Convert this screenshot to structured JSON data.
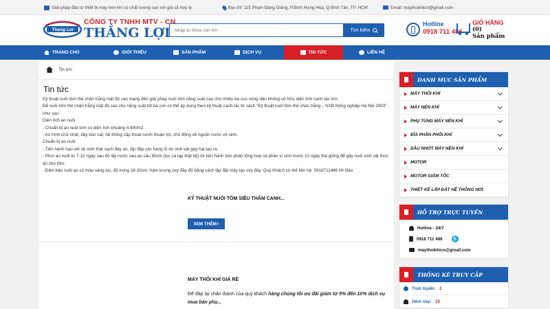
{
  "topbar": {
    "slogan": "Giải pháp đầu tư thiết bị máy nén khí có chất lượng cao với giá cả hợp lý",
    "address": "Địa chỉ: 115 Phạm Đăng Giảng, P.Bình Hưng Hòa, Q.Bình Tân, TP. HCM",
    "email": "Email: maythoikhicn@gmail.com"
  },
  "header": {
    "logo_text": "Thang Loi",
    "company_line1": "CÔNG TY TNHH MTV - CN",
    "company_line2": "THẮNG LỢI",
    "search_placeholder": "Nhập từ khóa cần tìm",
    "search_button": "Tìm kiếm",
    "hotline_label": "Hotline",
    "hotline_number": "0918 711 486",
    "cart_label": "GIỎ HÀNG",
    "cart_count": "(0)",
    "cart_unit": "Sản phẩm"
  },
  "nav": {
    "items": [
      {
        "label": "TRANG CHỦ",
        "icon": "home-icon"
      },
      {
        "label": "GIỚI THIỆU",
        "icon": "info-icon"
      },
      {
        "label": "SẢN PHẨM",
        "icon": "truck-icon"
      },
      {
        "label": "DỊCH VỤ",
        "icon": "service-icon"
      },
      {
        "label": "TIN TỨC",
        "icon": "news-icon",
        "active": true
      },
      {
        "label": "LIÊN HỆ",
        "icon": "contact-icon"
      }
    ]
  },
  "breadcrumb": {
    "current": "Tin tức"
  },
  "main": {
    "title": "Tin tức",
    "paragraphs": [
      "Kỹ thuật nuôi tôm thẻ chân trắng mật độ cao mang đến giải pháp nuôi tôm năng suất cao cho nhiều bà con nông dân không sở hữu diện tích canh tác lớn.",
      "Để nuôi tôm thẻ chân trắng mật độ cao cho năng suất tốt bà con có thể áp dụng theo kỹ thuật canh tác từ sách \"Kỹ thuật nuôi tôm thẻ chân trắng – NXB Nông nghiệp Hà Nội 2003\" như sau:",
      "Diện tích ao nuôi",
      "- Chuẩn bị ao nuôi tôm có diện tích khoảng 4.600m2.",
      "- Ao hình chữ nhật, đáy bùn cát, hệ thống cấp thoát nước thuận lợi, chủ động về nguồn nước vệ sinh.",
      "Chuẩn bị ao nuôi",
      "- Tiến hành nạo vét vệ sinh thật sạch đáy ao, lắp đầy các hang lỗ do sinh vật gây hại tạo ra.",
      "- Phơi ao nuôi từ 7-10 ngày sau đó lấy nước vào ao sâu 60cm (lọc cá tạp thật kỹ) rồi tiến hành bón phân tổng hợp và phân vi sinh trước 10 ngày thả giống để gây nuôi sinh vật thức ăn cho tôm.",
      "- Đảm bảo nuôi ao có màu vàng lục, độ trong 26-30cm, hàm lượng oxy đầy đủ bằng cách lắp đặt máy tạo oxy đáy. Quý Khách có thể  liên hệ: 0918711486 Mr Bảo."
    ],
    "post1_title": "KỸ THUẬT NUÔI TÔM SIÊU THÂM CANH...",
    "more_button": "XEM THÊM>",
    "post2_title": "MÁY THỔI KHÍ GIÁ RẺ",
    "post2_desc_plain": "Để đáp lại chân thành của quý khách ",
    "post2_desc_bold": "hàng chúng tôi ưu đãi giảm từ 5% đến 10% dịch vụ mua bán phụ..."
  },
  "sidebar": {
    "categories_title": "DANH MỤC SẢN PHẨM",
    "categories": [
      {
        "label": "MÁY THỔI KHÍ",
        "expandable": true
      },
      {
        "label": "MÁY NÉN KHÍ",
        "expandable": true
      },
      {
        "label": "PHỤ TÙNG MÁY NÉN KHÍ",
        "expandable": true
      },
      {
        "label": "ĐĨA PHÂN PHỐI KHÍ",
        "expandable": true
      },
      {
        "label": "DẦU NHỚT MÁY NÉN KHÍ",
        "expandable": true
      },
      {
        "label": "MOTOR",
        "expandable": false
      },
      {
        "label": "MOTOR GIẢM TỐC",
        "expandable": false
      },
      {
        "label": "THIẾT KẾ LẮP ĐẶT HỆ THỐNG HƠI",
        "expandable": false
      }
    ],
    "support_title": "HỖ TRỢ TRỰC TUYẾN",
    "support_hotline_label": "Hotline - 24/7",
    "support_phone": "0918 711 486",
    "support_email": "maythoikhicn@gmail.com",
    "skype_glyph": "S",
    "stats_title": "THỐNG KÊ TRUY CẬP",
    "stats": [
      {
        "label": "Trực tuyến:",
        "value": "1"
      },
      {
        "label": "Hôm nay:",
        "value": "14"
      }
    ]
  },
  "colors": {
    "brand_blue": "#1e5fb0",
    "brand_red": "#d71f26"
  }
}
